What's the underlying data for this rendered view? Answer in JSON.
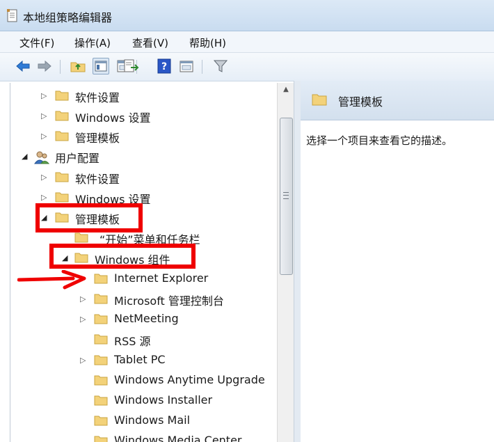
{
  "window": {
    "title": "本地组策略编辑器",
    "icon": "policy-document-icon"
  },
  "menu": [
    "文件(F)",
    "操作(A)",
    "查看(V)",
    "帮助(H)"
  ],
  "toolbar": [
    "back-arrow-icon",
    "forward-arrow-icon",
    "up-folder-icon",
    "show-hide-tree-icon",
    "export-list-icon",
    "help-icon",
    "properties-icon",
    "filter-icon"
  ],
  "tree": {
    "rows": [
      {
        "label": "软件设置",
        "expander": "▷"
      },
      {
        "label": "Windows 设置",
        "expander": "▷"
      },
      {
        "label": "管理模板",
        "expander": "▷"
      },
      {
        "label": "用户配置",
        "expander": "◢"
      },
      {
        "label": "软件设置",
        "expander": "▷"
      },
      {
        "label": "Windows 设置",
        "expander": "▷"
      },
      {
        "label": "管理模板",
        "expander": "◢"
      },
      {
        "label": "“开始”菜单和任务栏",
        "expander": ""
      },
      {
        "label": "Windows 组件",
        "expander": "◢"
      },
      {
        "label": "Internet Explorer",
        "expander": ""
      },
      {
        "label": "Microsoft 管理控制台",
        "expander": "▷"
      },
      {
        "label": "NetMeeting",
        "expander": "▷"
      },
      {
        "label": "RSS 源",
        "expander": ""
      },
      {
        "label": "Tablet PC",
        "expander": "▷"
      },
      {
        "label": "Windows Anytime Upgrade",
        "expander": ""
      },
      {
        "label": "Windows Installer",
        "expander": ""
      },
      {
        "label": "Windows Mail",
        "expander": ""
      },
      {
        "label": "Windows Media Center",
        "expander": ""
      }
    ]
  },
  "details": {
    "title": "管理模板",
    "description": "选择一个项目来查看它的描述。"
  },
  "colors": {
    "highlight": "#ef0000",
    "folder": "#f3d27a",
    "folder_edge": "#c9a440"
  }
}
